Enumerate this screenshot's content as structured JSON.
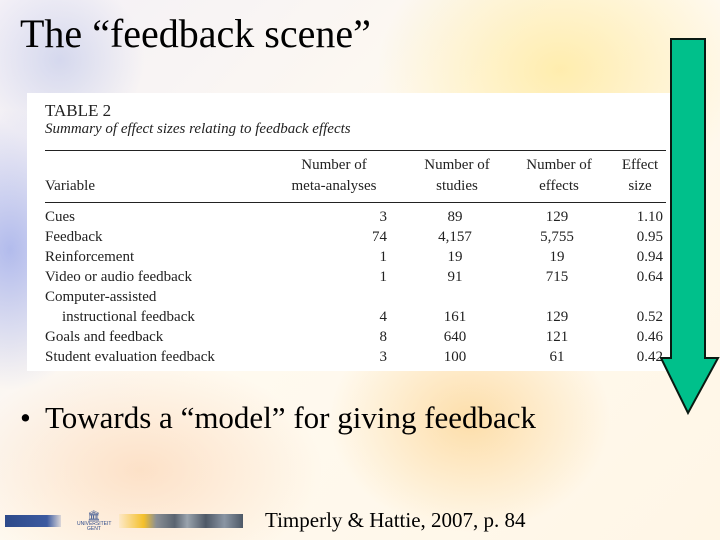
{
  "slide": {
    "title": "The “feedback scene”",
    "bullet": "Towards a “model” for giving feedback",
    "bullet_marker": "•",
    "citation": "Timperly & Hattie, 2007, p. 84",
    "logo": {
      "name": "Universiteit Gent logo",
      "line1": "UNIVERSITEIT",
      "line2": "GENT",
      "building_glyph": "🏛"
    },
    "arrow": {
      "icon": "arrow-down-icon",
      "fill": "#00c08b",
      "stroke": "#0a1a12"
    }
  },
  "table": {
    "number": "TABLE 2",
    "caption": "Summary of effect sizes relating to feedback effects",
    "headers": {
      "variable": "Variable",
      "meta_analyses": [
        "Number of",
        "meta-analyses"
      ],
      "studies": [
        "Number of",
        "studies"
      ],
      "effects": [
        "Number of",
        "effects"
      ],
      "effect_size": [
        "Effect",
        "size"
      ]
    },
    "rows": [
      {
        "variable": "Cues",
        "meta_analyses": "3",
        "studies": "89",
        "effects": "129",
        "effect_size": "1.10"
      },
      {
        "variable": "Feedback",
        "meta_analyses": "74",
        "studies": "4,157",
        "effects": "5,755",
        "effect_size": "0.95"
      },
      {
        "variable": "Reinforcement",
        "meta_analyses": "1",
        "studies": "19",
        "effects": "19",
        "effect_size": "0.94"
      },
      {
        "variable": "Video or audio feedback",
        "meta_analyses": "1",
        "studies": "91",
        "effects": "715",
        "effect_size": "0.64"
      },
      {
        "variable": "Computer-assisted",
        "variable_cont": "instructional feedback",
        "meta_analyses": "4",
        "studies": "161",
        "effects": "129",
        "effect_size": "0.52"
      },
      {
        "variable": "Goals and feedback",
        "meta_analyses": "8",
        "studies": "640",
        "effects": "121",
        "effect_size": "0.46"
      },
      {
        "variable": "Student evaluation feedback",
        "meta_analyses": "3",
        "studies": "100",
        "effects": "61",
        "effect_size": "0.42"
      }
    ]
  }
}
